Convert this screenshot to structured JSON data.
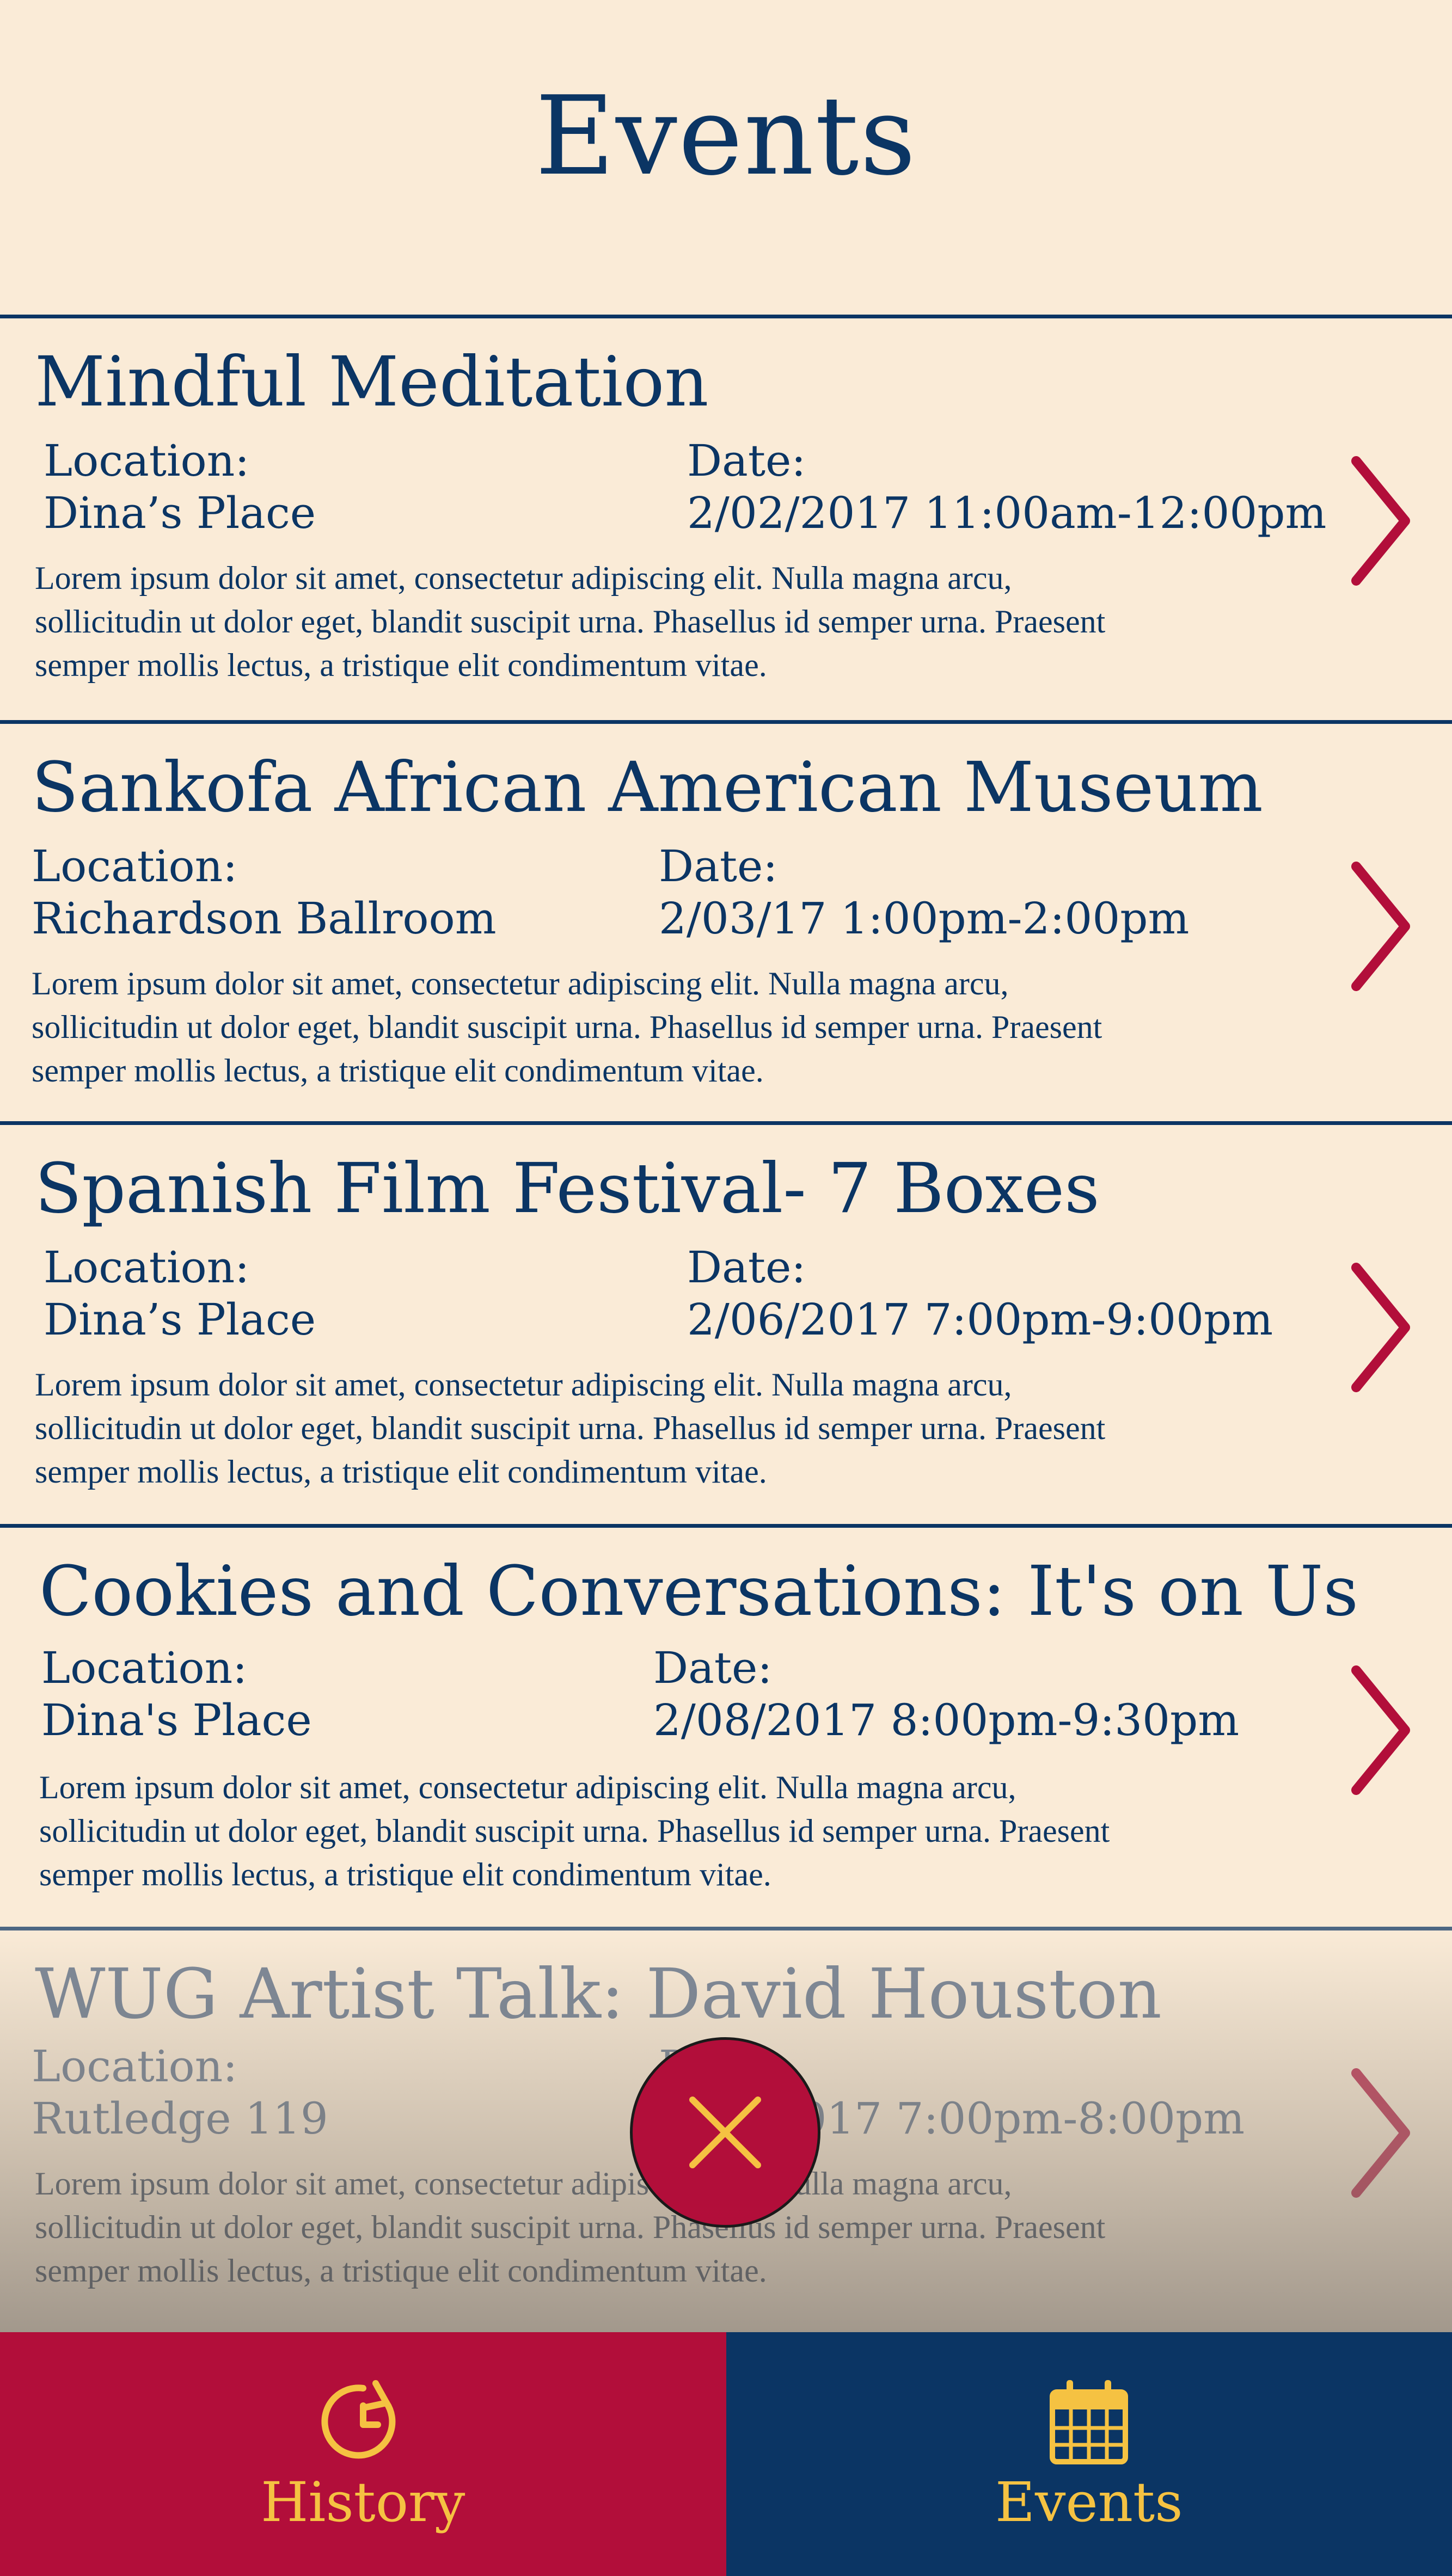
{
  "header": {
    "title": "Events"
  },
  "colors": {
    "navy": "#0b3564",
    "crimson": "#b20e3a",
    "gold": "#f5c242",
    "cream": "#faebd7"
  },
  "labels": {
    "location": "Location:",
    "date": "Date:"
  },
  "events": [
    {
      "title": "Mindful Meditation",
      "location": "Dina’s Place",
      "date": "2/02/2017 11:00am-12:00pm",
      "description": "Lorem ipsum dolor sit amet, consectetur adipiscing elit. Nulla magna arcu, sollicitudin ut dolor eget, blandit suscipit urna. Phasellus id semper urna. Praesent semper mollis lectus, a tristique elit condimentum vitae."
    },
    {
      "title": "Sankofa African American Museum",
      "location": "Richardson Ballroom",
      "date": "2/03/17 1:00pm-2:00pm",
      "description": "Lorem ipsum dolor sit amet, consectetur adipiscing elit. Nulla magna arcu, sollicitudin ut dolor eget, blandit suscipit urna. Phasellus id semper urna. Praesent semper mollis lectus, a tristique elit condimentum vitae."
    },
    {
      "title": "Spanish Film Festival- 7 Boxes",
      "location": "Dina’s Place",
      "date": "2/06/2017 7:00pm-9:00pm",
      "description": "Lorem ipsum dolor sit amet, consectetur adipiscing elit. Nulla magna arcu, sollicitudin ut dolor eget, blandit suscipit urna. Phasellus id semper urna. Praesent semper mollis lectus, a tristique elit condimentum vitae."
    },
    {
      "title": "Cookies and Conversations: It's on Us",
      "location": "Dina's Place",
      "date": "2/08/2017 8:00pm-9:30pm",
      "description": "Lorem ipsum dolor sit amet, consectetur adipiscing elit. Nulla magna arcu, sollicitudin ut dolor eget, blandit suscipit urna. Phasellus id semper urna. Praesent semper mollis lectus, a tristique elit condimentum vitae."
    },
    {
      "title": "WUG Artist Talk: David Houston",
      "location": "Rutledge 119",
      "date": "2/10/2017 7:00pm-8:00pm",
      "description": "Lorem ipsum dolor sit amet, consectetur adipiscing elit. Nulla magna arcu, sollicitudin ut dolor eget, blandit suscipit urna. Phasellus id semper urna. Praesent semper mollis lectus, a tristique elit condimentum vitae."
    }
  ],
  "fab": {
    "icon": "close-icon"
  },
  "tabbar": {
    "history": {
      "label": "History",
      "icon": "history-icon"
    },
    "events": {
      "label": "Events",
      "icon": "calendar-icon"
    }
  }
}
